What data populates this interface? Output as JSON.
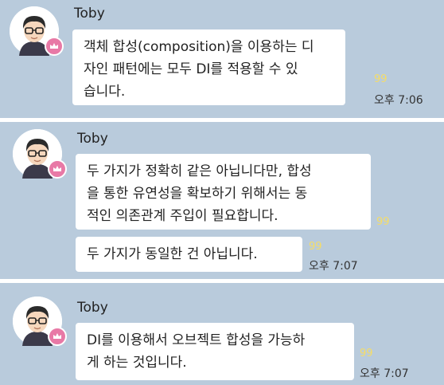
{
  "groups": [
    {
      "sender": "Toby",
      "messages": [
        {
          "lines": [
            "객체 합성(composition)을 이용하는 디",
            "자인 패턴에는 모두 DI를 적용할 수 있",
            "습니다."
          ],
          "unread": "99",
          "time": "오후 7:06"
        }
      ]
    },
    {
      "sender": "Toby",
      "messages": [
        {
          "lines": [
            "두 가지가 정확히 같은 아닙니다만, 합성",
            "을 통한 유연성을 확보하기 위해서는 동",
            "적인 의존관계 주입이 필요합니다."
          ],
          "unread": "99"
        },
        {
          "lines": [
            "두 가지가 동일한 건 아닙니다."
          ],
          "unread": "99",
          "time": "오후 7:07"
        }
      ]
    },
    {
      "sender": "Toby",
      "messages": [
        {
          "lines": [
            "DI를 이용해서 오브젝트 합성을 가능하",
            "게 하는 것입니다."
          ],
          "unread": "99",
          "time": "오후 7:07"
        }
      ]
    }
  ]
}
